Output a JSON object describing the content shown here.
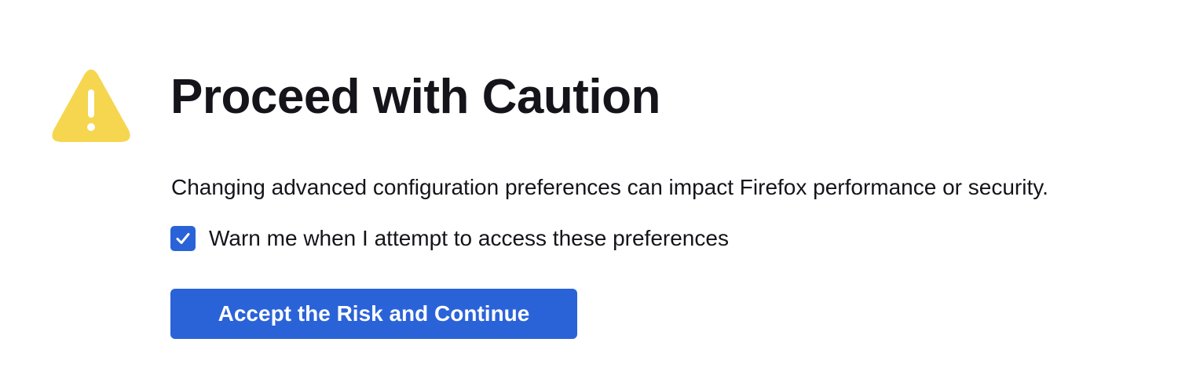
{
  "warning": {
    "icon": "warning-triangle-icon",
    "color": "#f5d64e"
  },
  "title": "Proceed with Caution",
  "description": "Changing advanced configuration preferences can impact Firefox performance or security.",
  "warn_checkbox": {
    "label": "Warn me when I attempt to access these preferences",
    "checked": true,
    "icon": "checkmark-icon"
  },
  "accept_button": {
    "label": "Accept the Risk and Continue"
  },
  "colors": {
    "accent": "#2a63d8",
    "warning": "#f5d64e",
    "text": "#15141a",
    "background": "#ffffff"
  }
}
